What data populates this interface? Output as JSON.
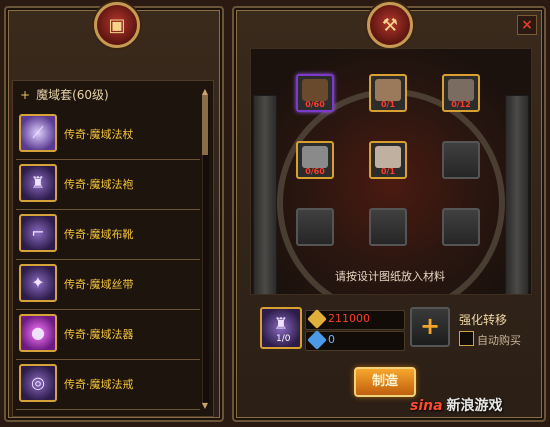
{
  "left_panel": {
    "category": "魔域套(60级)",
    "items": [
      {
        "label": "传奇·魔域法杖",
        "icon": "staff-icon"
      },
      {
        "label": "传奇·魔域法袍",
        "icon": "robe-icon"
      },
      {
        "label": "传奇·魔域布靴",
        "icon": "boots-icon"
      },
      {
        "label": "传奇·魔域丝带",
        "icon": "sash-icon"
      },
      {
        "label": "传奇·魔域法器",
        "icon": "orb-icon"
      },
      {
        "label": "传奇·魔域法戒",
        "icon": "ring-icon"
      }
    ]
  },
  "right_panel": {
    "close_label": "×",
    "materials": [
      {
        "count": "0/60",
        "color": "#6a4a2c",
        "selected": true
      },
      {
        "count": "0/1",
        "color": "#9a7a5a",
        "selected": false
      },
      {
        "count": "0/12",
        "color": "#7a6c60",
        "selected": false
      },
      {
        "count": "0/60",
        "color": "#8a8a8a",
        "selected": false
      },
      {
        "count": "0/1",
        "color": "#c0b0a0",
        "selected": false
      }
    ],
    "hint": "请按设计图纸放入材料",
    "product_qty": "1/0",
    "gold_cost": "211000",
    "gem_cost": "0",
    "transfer_label": "强化转移",
    "auto_buy_label": "自动购买",
    "craft_label": "制造"
  },
  "watermark": {
    "logo": "sina",
    "text": "新浪游戏"
  },
  "colors": {
    "gold": "#f3c43a",
    "cost_red": "#ff3c2a",
    "gem_blue": "#6ab4ff",
    "accent": "#d7a02f"
  }
}
